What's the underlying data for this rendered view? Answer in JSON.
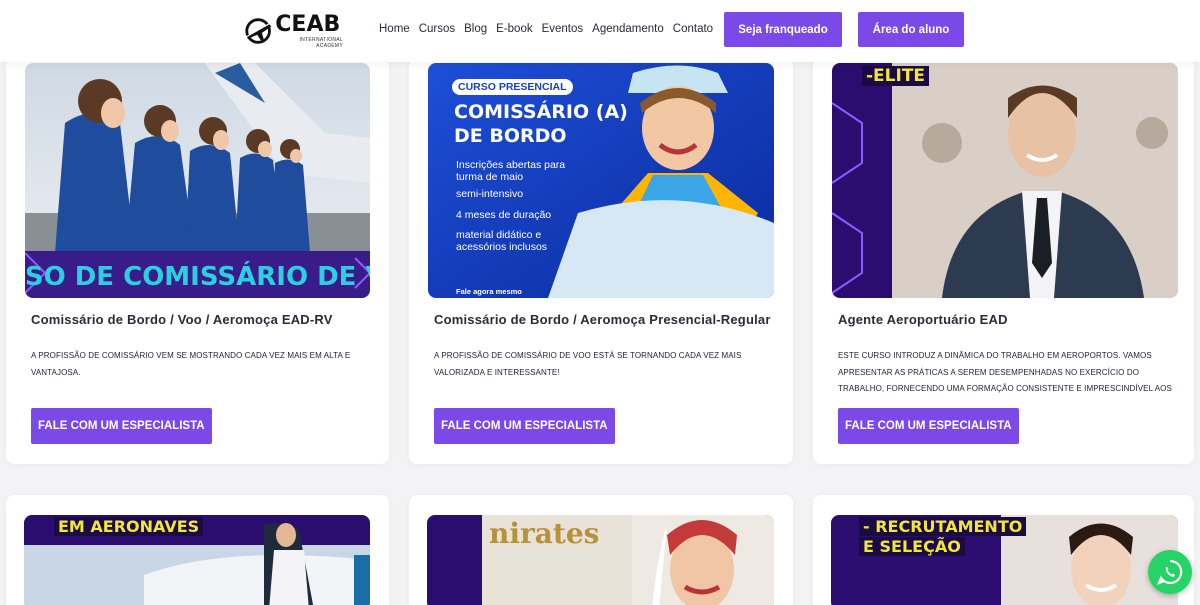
{
  "header": {
    "logo_text": "CEAB",
    "logo_sub": "INTERNATIONAL ACADEMY",
    "nav": [
      "Home",
      "Cursos",
      "Blog",
      "E-book",
      "Eventos",
      "Agendamento",
      "Contato"
    ],
    "cta_franchise": "Seja franqueado",
    "cta_student": "Área do aluno"
  },
  "cards": [
    {
      "title": "Comissário de Bordo / Voo / Aeromoça EAD-RV",
      "description": "A PROFISSÃO DE COMISSÁRIO VEM SE MOSTRANDO CADA VEZ MAIS EM ALTA E VANTAJOSA.",
      "button": "FALE COM UM ESPECIALISTA",
      "image_text": "CURSO DE COMISSÁRIO DE VOO"
    },
    {
      "title": "Comissário de Bordo / Aeromoça Presencial-Regular",
      "description": "A PROFISSÃO DE COMISSÁRIO DE VOO ESTÁ SE TORNANDO CADA VEZ MAIS VALORIZADA E INTERESSANTE!",
      "button": "FALE COM UM ESPECIALISTA",
      "image": {
        "tag": "CURSO PRESENCIAL",
        "headline1": "COMISSÁRIO (A)",
        "headline2": "DE BORDO",
        "bullets": [
          "Inscrições abertas para turma de maio",
          "semi-intensivo",
          "4 meses de duração",
          "material didático e acessórios inclusos"
        ],
        "footer": "Fale agora mesmo"
      }
    },
    {
      "title": "Agente Aeroportuário EAD",
      "description": "ESTE CURSO INTRODUZ A DINÂMICA DO TRABALHO EM AEROPORTOS. VAMOS APRESENTAR AS PRÁTICAS A SEREM DESEMPENHADAS NO EXERCÍCIO DO TRABALHO, FORNECENDO UMA FORMAÇÃO CONSISTENTE E IMPRESCINDÍVEL AOS ASPIRANTES À",
      "button": "FALE COM UM ESPECIALISTA",
      "image_text": "-ELITE"
    }
  ],
  "row2_images": [
    {
      "text": "EM AERONAVES"
    },
    {
      "text": "nirates"
    },
    {
      "text1": "- RECRUTAMENTO",
      "text2": "E SELEÇÃO"
    }
  ],
  "colors": {
    "accent": "#7b49e8",
    "whatsapp": "#25d366"
  }
}
